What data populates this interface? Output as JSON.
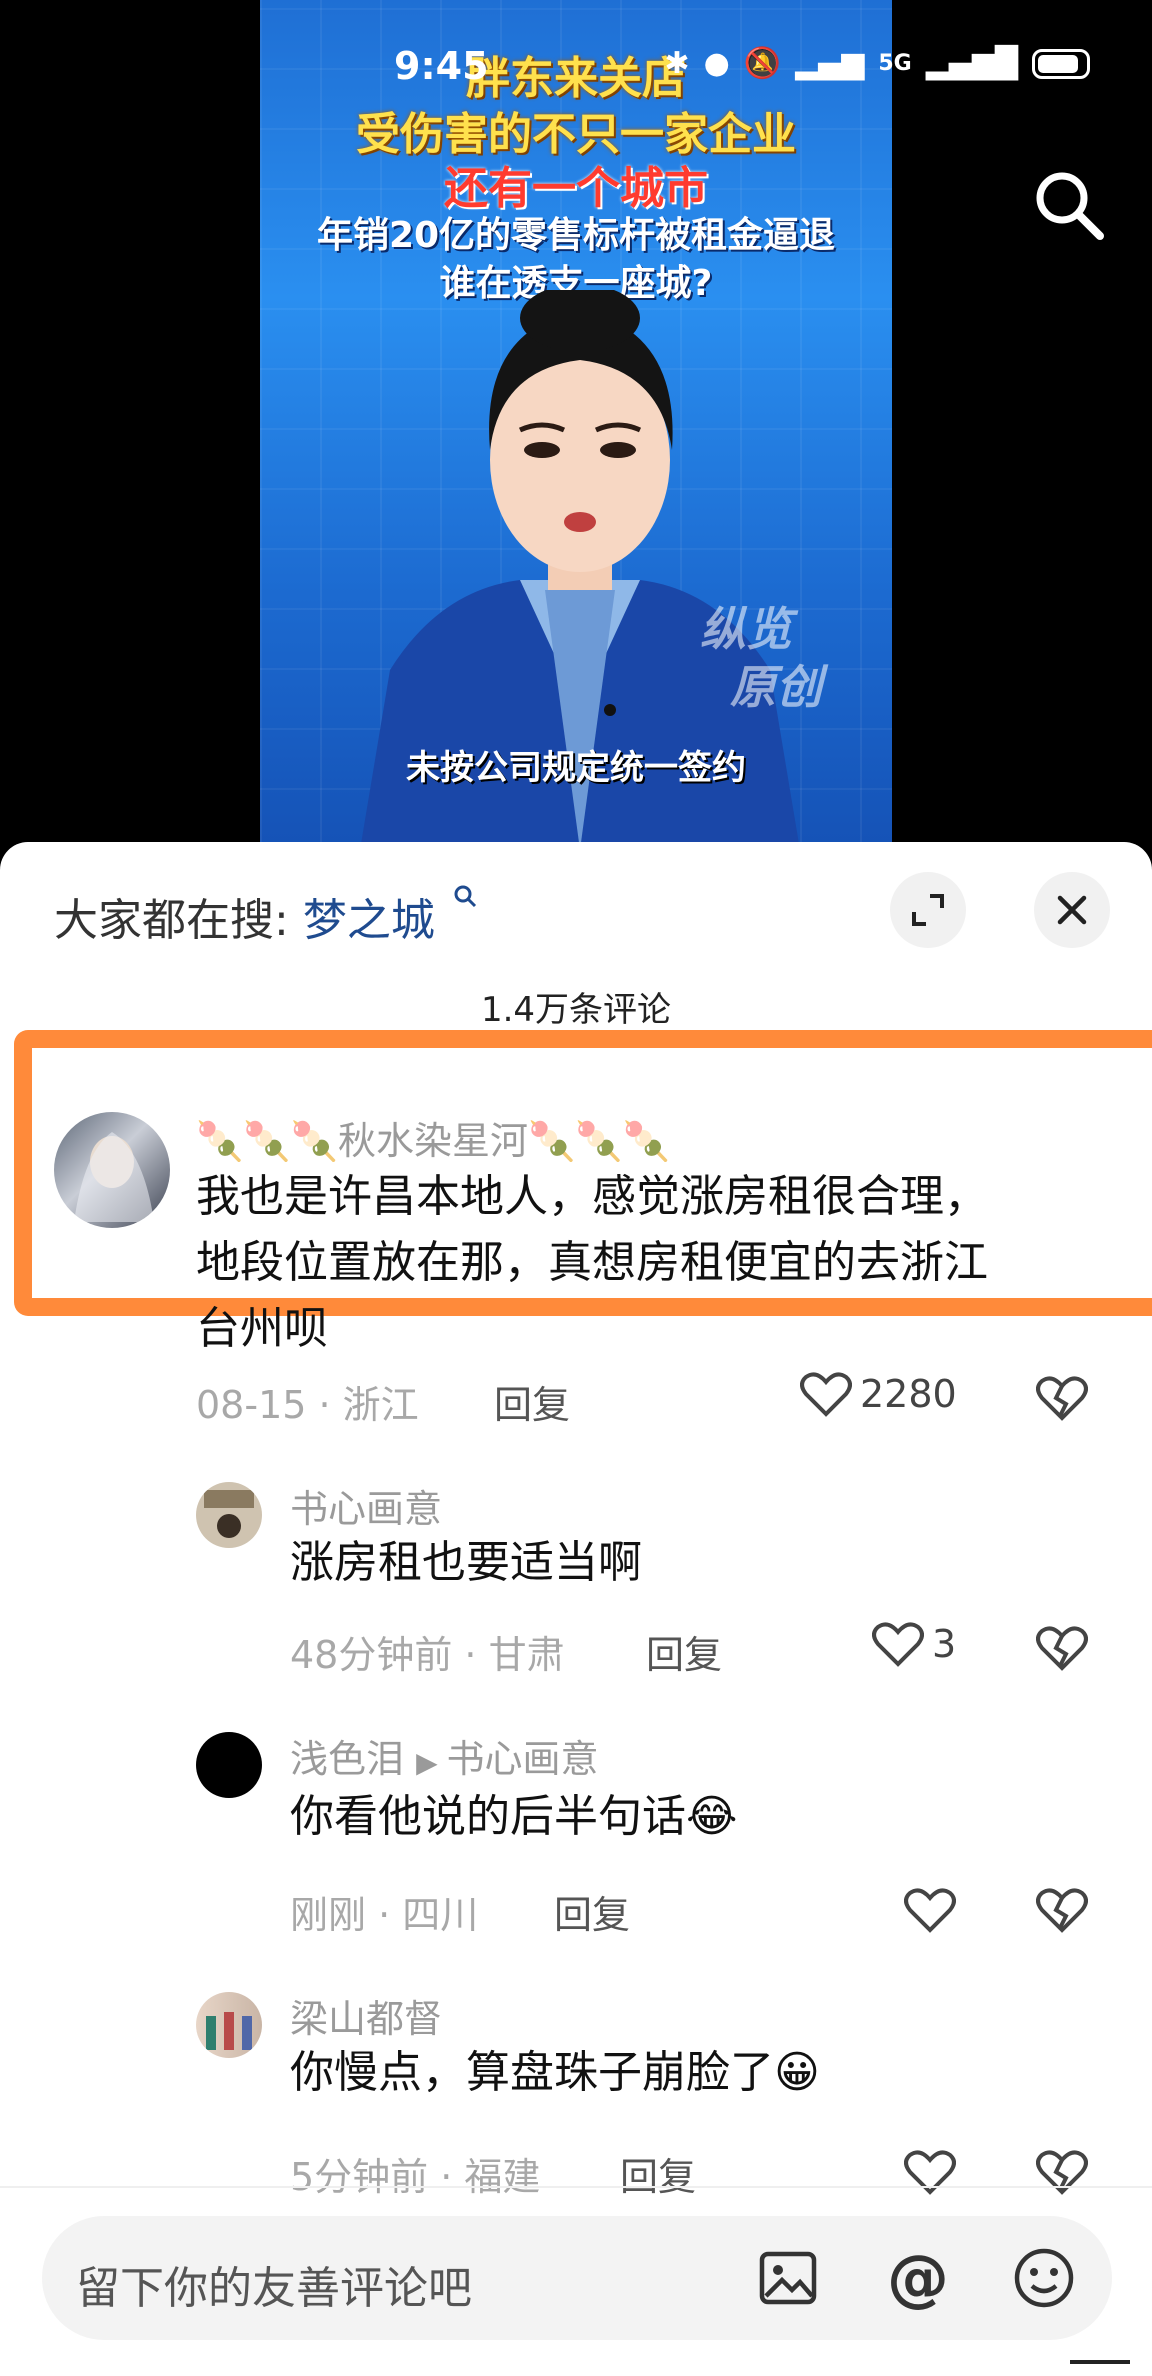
{
  "status_bar": {
    "time": "9:45",
    "network": "5G"
  },
  "video": {
    "headline_1": "胖东来关店",
    "headline_2": "受伤害的不只一家企业",
    "headline_3": "还有一个城市",
    "headline_4": "年销20亿的零售标杆被租金逼退",
    "headline_5": "谁在透支一座城?",
    "watermark_1": "纵览",
    "watermark_2": "原创",
    "subtitle": "未按公司规定统一签约"
  },
  "sheet": {
    "hot_search_label": "大家都在搜:",
    "hot_search_term": "梦之城",
    "comment_count": "1.4万条评论"
  },
  "comments": [
    {
      "author": "🍡🍡🍡秋水染星河🍡🍡🍡",
      "lines": [
        "我也是许昌本地人，感觉涨房租很合理，",
        "地段位置放在那，真想房租便宜的去浙江",
        "台州呗"
      ],
      "meta": "08-15 · 浙江",
      "reply": "回复",
      "likes": "2280"
    },
    {
      "author": "书心画意",
      "lines": [
        "涨房租也要适当啊"
      ],
      "meta": "48分钟前 · 甘肃",
      "reply": "回复",
      "likes": "3"
    },
    {
      "author": "浅色泪",
      "reply_to": "书心画意",
      "lines": [
        "你看他说的后半句话😂"
      ],
      "meta": "刚刚 · 四川",
      "reply": "回复",
      "likes": ""
    },
    {
      "author": "梁山都督",
      "lines": [
        "你慢点，算盘珠子崩脸了😀"
      ],
      "meta": "5分钟前 · 福建",
      "reply": "回复",
      "likes": ""
    }
  ],
  "input": {
    "placeholder": "留下你的友善评论吧"
  },
  "colors": {
    "highlight": "#ff8a3a",
    "link": "#1f4b8f",
    "video_bg": "#2a8ff0"
  }
}
